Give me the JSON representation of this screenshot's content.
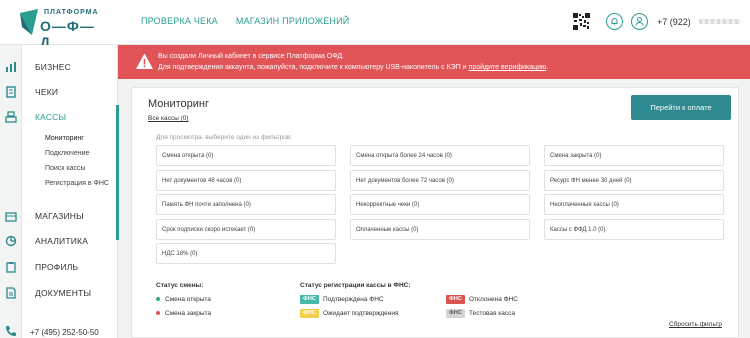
{
  "header": {
    "logo_top": "ПЛАТФОРМА",
    "logo_main": "О—Ф—Д",
    "nav": [
      "ПРОВЕРКА ЧЕКА",
      "МАГАЗИН ПРИЛОЖЕНИЙ"
    ],
    "phone": "+7 (922)",
    "accent": "#2a9d8f"
  },
  "sidebar": {
    "items": [
      {
        "label": "БИЗНЕС",
        "icon": "bar-chart-icon"
      },
      {
        "label": "ЧЕКИ",
        "icon": "receipt-icon"
      },
      {
        "label": "КАССЫ",
        "icon": "cash-register-icon"
      },
      {
        "label": "МАГАЗИНЫ",
        "icon": "store-icon"
      },
      {
        "label": "АНАЛИТИКА",
        "icon": "pie-chart-icon"
      },
      {
        "label": "ПРОФИЛЬ",
        "icon": "clipboard-icon"
      },
      {
        "label": "ДОКУМЕНТЫ",
        "icon": "document-icon"
      }
    ],
    "subitems": [
      "Мониторинг",
      "Подключение",
      "Поиск кассы",
      "Регистрация в ФНС"
    ],
    "phone": "+7 (495) 252-50-50"
  },
  "alert": {
    "line1": "Вы создали Личный кабинет в сервисе Платформа ОФД.",
    "line2": "Для подтверждения аккаунта, пожалуйста, подключите к компьютеру USB-накопитель с КЭП и",
    "link": "пройдите верификацию",
    "end": ".",
    "color": "#e05457"
  },
  "monitoring": {
    "title": "Мониторинг",
    "all": "Все кассы (0)",
    "pay_button": "Перейти к оплате",
    "hint": "Для просмотра, выберите один из фильтров:",
    "filters": [
      "Смена открыта (0)",
      "Смена открыта более 24 часов (0)",
      "Смена закрыта (0)",
      "Нет документов 48 часов (0)",
      "Нет документов более 72 часов (0)",
      "Ресурс ФН менее 30 дней (0)",
      "Память ФН почти заполнена (0)",
      "Некорректные чеки (0)",
      "Неоплаченные кассы (0)",
      "Срок подписки скоро истекает (0)",
      "Оплаченные кассы (0)",
      "Кассы с ФФД 1.0 (0)",
      "НДС 18% (0)"
    ],
    "shift_title": "Статус смены:",
    "shift": [
      {
        "label": "Смена открыта",
        "color": "#3aa876"
      },
      {
        "label": "Смена закрыта",
        "color": "#e05457"
      }
    ],
    "fns_title": "Статус регистрации кассы в ФНС:",
    "fns_tag": "ФНС",
    "fns": [
      {
        "label": "Подтверждена ФНС",
        "color": "#45b7ab"
      },
      {
        "label": "Ожидает подтверждения",
        "color": "#f2cf4a"
      },
      {
        "label": "Отклонена ФНС",
        "color": "#d9534f"
      },
      {
        "label": "Тестовая касса",
        "color": "#d4d6d6"
      }
    ],
    "reset": "Сбросить фильтр"
  }
}
